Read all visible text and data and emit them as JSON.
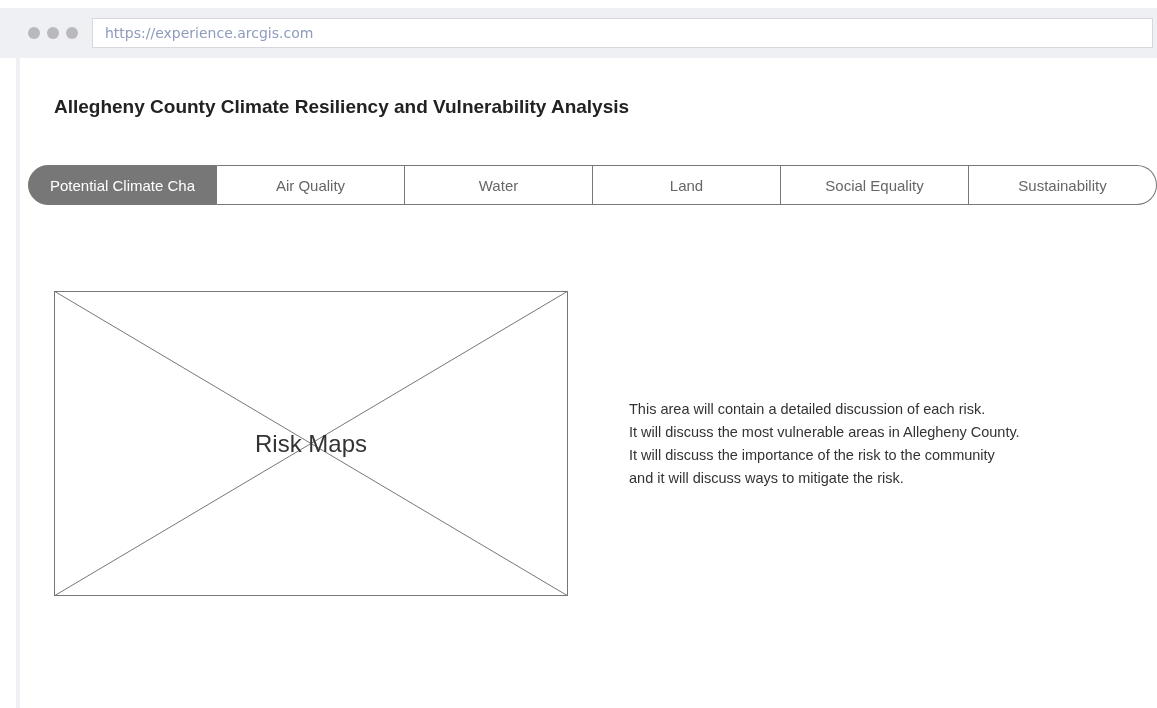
{
  "browser": {
    "url": "https://experience.arcgis.com"
  },
  "page": {
    "title": "Allegheny County Climate Resiliency and Vulnerability Analysis"
  },
  "tabs": [
    {
      "label": "Potential Climate Cha",
      "selected": true
    },
    {
      "label": "Air Quality",
      "selected": false
    },
    {
      "label": "Water",
      "selected": false
    },
    {
      "label": "Land",
      "selected": false
    },
    {
      "label": "Social Equality",
      "selected": false
    },
    {
      "label": "Sustainability",
      "selected": false
    }
  ],
  "placeholder": {
    "label": "Risk Maps"
  },
  "description": {
    "lines": [
      "This area will contain a detailed discussion of each risk.",
      "It will discuss the most vulnerable areas in Allegheny County.",
      "It will discuss the importance of the risk to the community",
      "and it will discuss ways to mitigate the risk."
    ]
  }
}
